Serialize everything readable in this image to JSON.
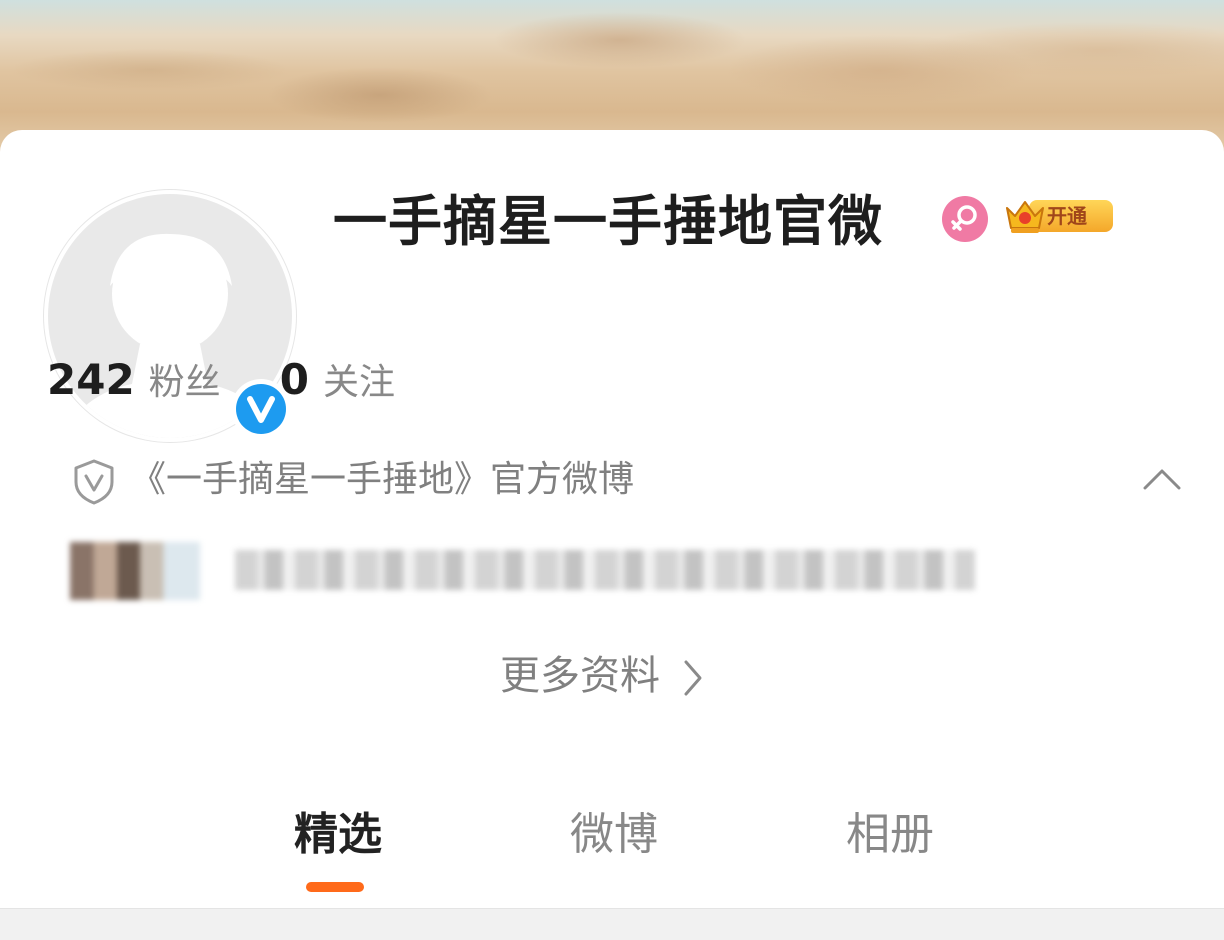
{
  "profile": {
    "name": "一手摘星一手捶地官微",
    "vip_label": "开通",
    "followers_count": "242",
    "followers_label": "粉丝",
    "following_count": "0",
    "following_label": "关注",
    "verified_intro": "《一手摘星一手捶地》官方微博",
    "more_info_label": "更多资料"
  },
  "tabs": [
    {
      "label": "精选",
      "active": true
    },
    {
      "label": "微博",
      "active": false
    },
    {
      "label": "相册",
      "active": false
    }
  ],
  "colors": {
    "verified_blue": "#1d9bf0",
    "tab_indicator": "#ff6a1a",
    "female_badge": "#f07aa4",
    "vip_gold": "#f4a72a"
  },
  "icons": {
    "verified": "verified-v-icon",
    "gender": "female-icon",
    "vip": "crown-icon",
    "intro": "shield-v-icon",
    "collapse": "chevron-up-icon",
    "more": "chevron-right-icon"
  }
}
